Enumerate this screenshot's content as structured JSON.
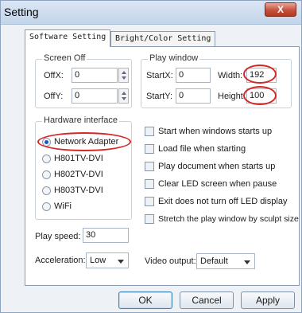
{
  "window": {
    "title": "Setting",
    "close_glyph": "X"
  },
  "tabs": [
    {
      "label": "Software Setting",
      "active": true
    },
    {
      "label": "Bright/Color Setting",
      "active": false
    }
  ],
  "screen_off": {
    "legend": "Screen Off",
    "offx_label": "OffX:",
    "offx_value": "0",
    "offy_label": "OffY:",
    "offy_value": "0"
  },
  "play_window": {
    "legend": "Play window",
    "startx_label": "StartX:",
    "startx_value": "0",
    "starty_label": "StartY:",
    "starty_value": "0",
    "width_label": "Width:",
    "width_value": "192",
    "height_label": "Height:",
    "height_value": "100"
  },
  "hardware": {
    "legend": "Hardware interface",
    "options": [
      "Network Adapter",
      "H801TV-DVI",
      "H802TV-DVI",
      "H803TV-DVI",
      "WiFi"
    ],
    "selected": "Network Adapter"
  },
  "options": [
    "Start when windows starts up",
    "Load file when starting",
    "Play document when starts up",
    "Clear LED screen when pause",
    "Exit does not turn off LED display",
    "Stretch the play window by  sculpt size"
  ],
  "play_speed": {
    "label": "Play speed:",
    "value": "30"
  },
  "acceleration": {
    "label": "Acceleration:",
    "value": "Low"
  },
  "video_output": {
    "label": "Video output:",
    "value": "Default"
  },
  "buttons": {
    "ok": "OK",
    "cancel": "Cancel",
    "apply": "Apply"
  },
  "colors": {
    "highlight": "#d42828",
    "title_bar": "#c3d5ea",
    "close": "#c6513c"
  }
}
